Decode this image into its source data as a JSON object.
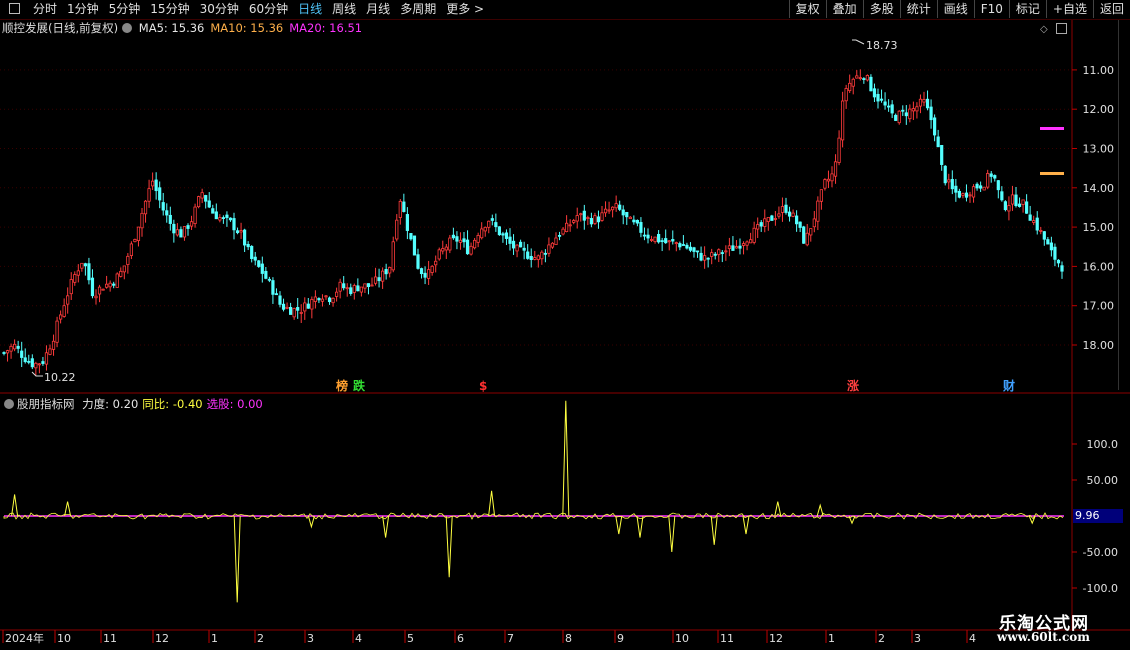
{
  "toolbar": {
    "periods": [
      {
        "label": "分时"
      },
      {
        "label": "1分钟"
      },
      {
        "label": "5分钟"
      },
      {
        "label": "15分钟"
      },
      {
        "label": "30分钟"
      },
      {
        "label": "60分钟"
      },
      {
        "label": "日线",
        "active": true
      },
      {
        "label": "周线"
      },
      {
        "label": "月线"
      },
      {
        "label": "多周期"
      },
      {
        "label": "更多 >"
      }
    ],
    "buttons": [
      {
        "label": "复权"
      },
      {
        "label": "叠加"
      },
      {
        "label": "多股"
      },
      {
        "label": "统计"
      },
      {
        "label": "画线"
      },
      {
        "label": "F10"
      },
      {
        "label": "标记"
      },
      {
        "label": "+自选"
      },
      {
        "label": "返回"
      }
    ]
  },
  "main_chart": {
    "title": "顺控发展(日线,前复权)",
    "ma": [
      {
        "label": "MA5:",
        "value": "15.36",
        "color": "#e6e6e6"
      },
      {
        "label": "MA10:",
        "value": "15.36",
        "color": "#ffb04a"
      },
      {
        "label": "MA20:",
        "value": "16.51",
        "color": "#ff33ff"
      }
    ],
    "y_ticks": [
      "18.00",
      "17.00",
      "16.00",
      "15.00",
      "14.00",
      "13.00",
      "12.00",
      "11.00"
    ],
    "high_label": "18.73",
    "low_label": "10.22",
    "markers": [
      {
        "text": "榜",
        "color": "#ffa030"
      },
      {
        "text": "跌",
        "color": "#33dd33"
      },
      {
        "text": "$",
        "color": "#ff3030"
      },
      {
        "text": "涨",
        "color": "#ff4040"
      },
      {
        "text": "财",
        "color": "#40a0ff"
      }
    ]
  },
  "indicator": {
    "name": "股朋指标网",
    "params": [
      {
        "label": "力度:",
        "value": "0.20",
        "color": "#e6e6e6"
      },
      {
        "label": "同比:",
        "value": "-0.40",
        "color": "#ffff40"
      },
      {
        "label": "选股:",
        "value": "0.00",
        "color": "#ff33ff"
      }
    ],
    "y_ticks": [
      "100.0",
      "50.00",
      "-50.00",
      "-100.0"
    ],
    "current_value": "9.96"
  },
  "x_axis": {
    "labels": [
      "2024年",
      "10",
      "11",
      "12",
      "1",
      "2",
      "3",
      "4",
      "5",
      "6",
      "7",
      "8",
      "9",
      "10",
      "11",
      "12",
      "1",
      "2",
      "3",
      "4"
    ]
  },
  "watermark": {
    "title": "乐淘公式网",
    "url": "www.60lt.com"
  },
  "chart_data": {
    "type": "candlestick",
    "title": "顺控发展(日线,前复权)",
    "price_range": [
      10.22,
      18.73
    ],
    "price_axis_ticks": [
      11,
      12,
      13,
      14,
      15,
      16,
      17,
      18
    ],
    "close_approx": [
      10.8,
      11.0,
      10.7,
      10.5,
      10.6,
      11.2,
      12.0,
      12.7,
      13.2,
      12.3,
      12.5,
      12.6,
      12.9,
      13.6,
      14.4,
      15.2,
      14.5,
      14.0,
      13.8,
      14.2,
      14.9,
      14.4,
      14.2,
      14.1,
      13.8,
      13.2,
      12.9,
      12.5,
      12.0,
      11.9,
      11.9,
      12.1,
      12.3,
      12.2,
      12.5,
      12.4,
      12.5,
      12.5,
      12.7,
      13.0,
      14.8,
      13.8,
      12.9,
      12.8,
      13.3,
      13.6,
      13.7,
      13.4,
      13.9,
      14.2,
      13.9,
      13.6,
      13.4,
      13.3,
      13.2,
      13.5,
      13.8,
      14.0,
      14.3,
      14.2,
      14.2,
      14.4,
      14.5,
      14.2,
      14.0,
      13.8,
      13.7,
      13.6,
      13.6,
      13.5,
      13.3,
      13.2,
      13.3,
      13.4,
      13.5,
      13.7,
      13.9,
      14.1,
      14.3,
      14.5,
      14.2,
      13.6,
      14.3,
      15.1,
      15.4,
      17.5,
      17.8,
      17.9,
      17.4,
      17.1,
      16.8,
      16.9,
      17.0,
      17.2,
      16.6,
      15.3,
      14.9,
      14.8,
      15.0,
      15.1,
      15.4,
      14.5,
      14.7,
      14.6,
      14.2,
      13.8,
      13.3,
      13.0
    ],
    "indicator_spikes": {
      "series": "力度",
      "points": [
        [
          0.01,
          30
        ],
        [
          0.06,
          20
        ],
        [
          0.22,
          -120
        ],
        [
          0.29,
          -15
        ],
        [
          0.36,
          -30
        ],
        [
          0.42,
          -85
        ],
        [
          0.46,
          35
        ],
        [
          0.53,
          160
        ],
        [
          0.58,
          -25
        ],
        [
          0.6,
          -30
        ],
        [
          0.63,
          -50
        ],
        [
          0.67,
          -40
        ],
        [
          0.7,
          -25
        ],
        [
          0.73,
          20
        ],
        [
          0.77,
          15
        ],
        [
          0.8,
          -10
        ],
        [
          0.97,
          -10
        ]
      ],
      "ylim": [
        -120,
        160
      ]
    }
  }
}
